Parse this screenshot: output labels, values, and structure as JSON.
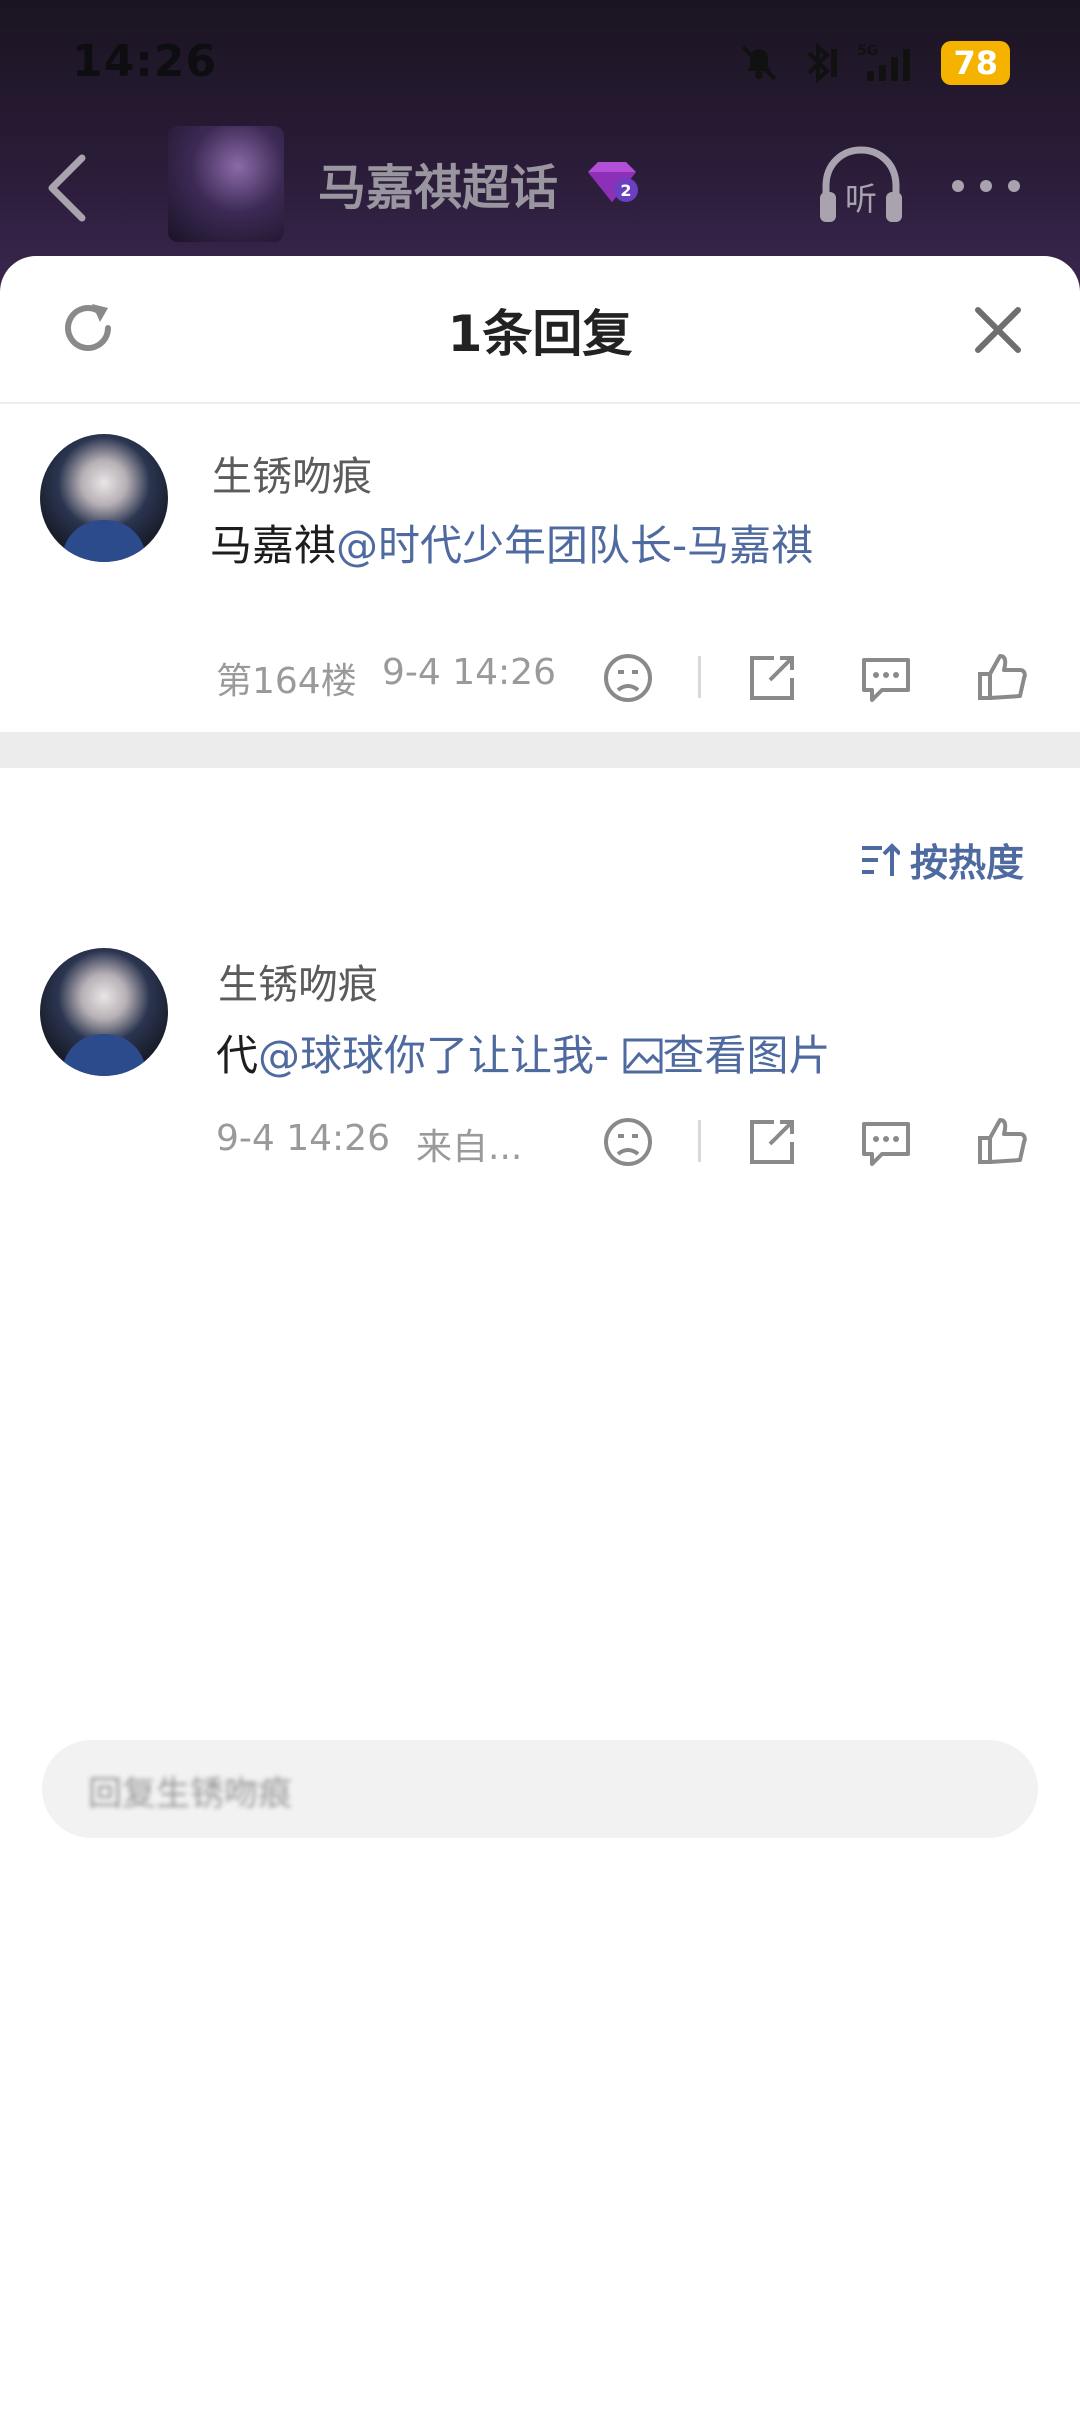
{
  "status_bar": {
    "time": "14:26",
    "network": "5G",
    "battery": "78"
  },
  "navbar": {
    "topic_title": "马嘉祺超话",
    "topic_level": "2",
    "listen_label": "听"
  },
  "sheet": {
    "title": "1条回复"
  },
  "main_comment": {
    "username": "生锈吻痕",
    "text_prefix": "马嘉祺",
    "mention": "@时代少年团队长-马嘉祺",
    "floor": "第164楼",
    "time": "9-4 14:26"
  },
  "sort": {
    "label": "按热度"
  },
  "reply": {
    "username": "生锈吻痕",
    "text_prefix": "代",
    "mention": "@球球你了让让我-",
    "image_link": "查看图片",
    "time": "9-4 14:26",
    "source": "来自..."
  },
  "input": {
    "placeholder": "回复生锈吻痕"
  },
  "colors": {
    "accent_link": "#4f6aa0",
    "battery": "#f5b300",
    "header_bg": "#2a1c38"
  }
}
